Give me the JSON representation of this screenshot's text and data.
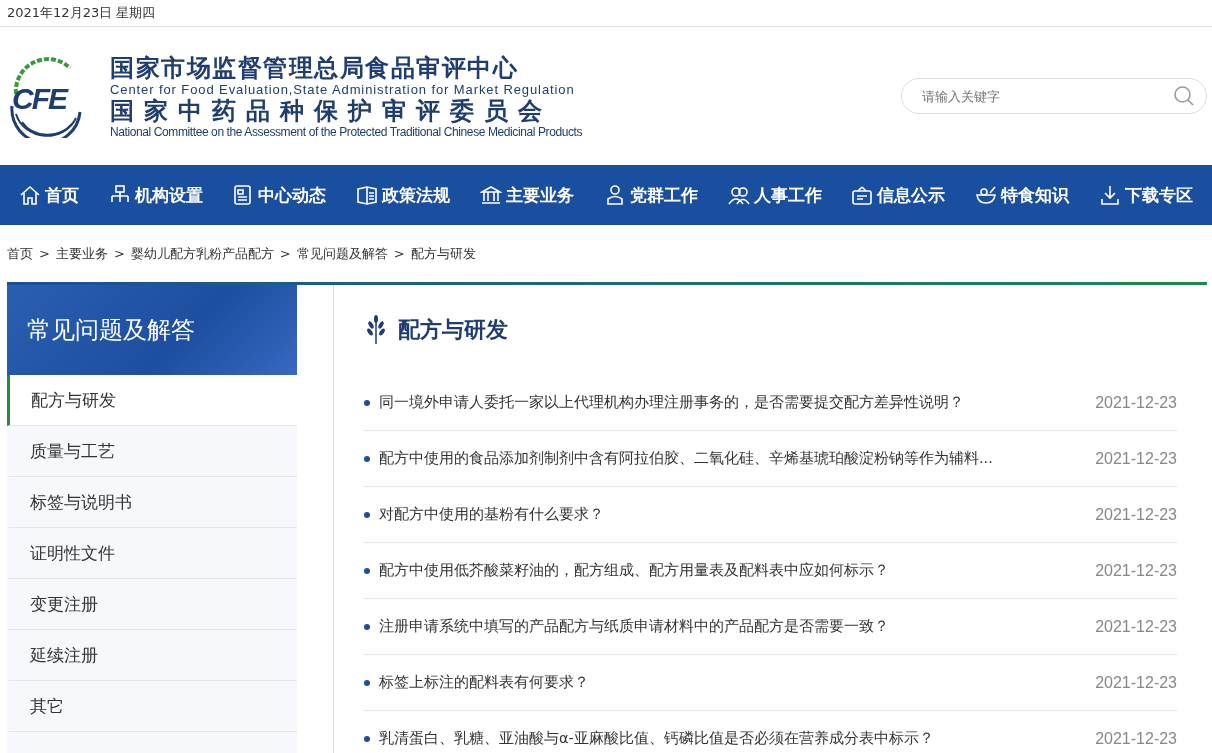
{
  "top_bar": {
    "date": "2021年12月23日 星期四"
  },
  "header": {
    "logo_text": "CFE",
    "title_cn_1": "国家市场监督管理总局食品审评中心",
    "title_en_1": "Center for Food Evaluation,State Administration for Market Regulation",
    "title_cn_2": "国家中药品种保护审评委员会",
    "title_en_2": "National Committee on the Assessment of the Protected Traditional Chinese Medicinal Products",
    "search": {
      "placeholder": "请输入关键字"
    }
  },
  "nav": [
    {
      "label": "首页",
      "kind": "home"
    },
    {
      "label": "机构设置",
      "kind": "org"
    },
    {
      "label": "中心动态",
      "kind": "news"
    },
    {
      "label": "政策法规",
      "kind": "policy"
    },
    {
      "label": "主要业务",
      "kind": "bank"
    },
    {
      "label": "党群工作",
      "kind": "person"
    },
    {
      "label": "人事工作",
      "kind": "people"
    },
    {
      "label": "信息公示",
      "kind": "notice"
    },
    {
      "label": "特食知识",
      "kind": "bowl"
    },
    {
      "label": "下载专区",
      "kind": "download"
    }
  ],
  "breadcrumb": {
    "separator": ">",
    "items": [
      "首页",
      "主要业务",
      "婴幼儿配方乳粉产品配方",
      "常见问题及解答",
      "配方与研发"
    ]
  },
  "sidebar": {
    "title": "常见问题及解答",
    "items": [
      {
        "label": "配方与研发",
        "selected": true
      },
      {
        "label": "质量与工艺",
        "selected": false
      },
      {
        "label": "标签与说明书",
        "selected": false
      },
      {
        "label": "证明性文件",
        "selected": false
      },
      {
        "label": "变更注册",
        "selected": false
      },
      {
        "label": "延续注册",
        "selected": false
      },
      {
        "label": "其它",
        "selected": false
      }
    ]
  },
  "content": {
    "title": "配方与研发",
    "articles": [
      {
        "title": "同一境外申请人委托一家以上代理机构办理注册事务的，是否需要提交配方差异性说明？",
        "date": "2021-12-23"
      },
      {
        "title": "配方中使用的食品添加剂制剂中含有阿拉伯胶、二氧化硅、辛烯基琥珀酸淀粉钠等作为辅料...",
        "date": "2021-12-23"
      },
      {
        "title": "对配方中使用的基粉有什么要求？",
        "date": "2021-12-23"
      },
      {
        "title": "配方中使用低芥酸菜籽油的，配方组成、配方用量表及配料表中应如何标示？",
        "date": "2021-12-23"
      },
      {
        "title": "注册申请系统中填写的产品配方与纸质申请材料中的产品配方是否需要一致？",
        "date": "2021-12-23"
      },
      {
        "title": "标签上标注的配料表有何要求？",
        "date": "2021-12-23"
      },
      {
        "title": "乳清蛋白、乳糖、亚油酸与α-亚麻酸比值、钙磷比值是否必须在营养成分表中标示？",
        "date": "2021-12-23"
      }
    ]
  }
}
